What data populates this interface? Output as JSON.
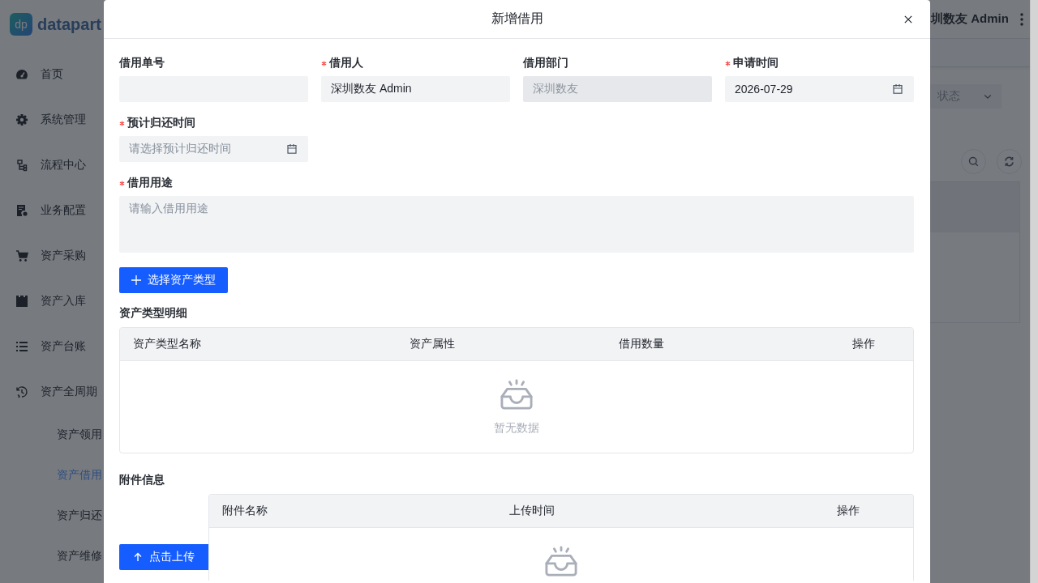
{
  "sidebar": {
    "logo": "dp",
    "brand": "datapart",
    "menu": [
      {
        "label": "首页",
        "selected": false
      },
      {
        "label": "系统管理",
        "selected": false
      },
      {
        "label": "流程中心",
        "selected": false
      },
      {
        "label": "业务配置",
        "selected": false
      },
      {
        "label": "资产采购",
        "selected": false
      },
      {
        "label": "资产入库",
        "selected": false
      },
      {
        "label": "资产台账",
        "selected": false
      },
      {
        "label": "资产全周期",
        "selected": false,
        "children": [
          {
            "label": "资产领用",
            "selected": false
          },
          {
            "label": "资产借用",
            "selected": true
          },
          {
            "label": "资产归还",
            "selected": false
          },
          {
            "label": "资产维修",
            "selected": false
          }
        ]
      }
    ]
  },
  "header": {
    "user": "圳数友 Admin"
  },
  "filters": {
    "status": {
      "placeholder": "状态"
    }
  },
  "modal": {
    "title": "新增借用",
    "fields": [
      {
        "label": "借用单号",
        "required": false,
        "kind": "input",
        "disabled": false
      },
      {
        "label": "借用人",
        "required": true,
        "kind": "input",
        "value": "深圳数友 Admin",
        "disabled": false
      },
      {
        "label": "借用部门",
        "required": false,
        "kind": "input",
        "value": "深圳数友",
        "disabled": true
      },
      {
        "label": "申请时间",
        "required": true,
        "kind": "date",
        "value": "2026-07-29",
        "disabled": false
      },
      {
        "label": "预计归还时间",
        "required": true,
        "kind": "date",
        "placeholder": "请选择预计归还时间",
        "disabled": false
      },
      {
        "label": "借用用途",
        "required": true,
        "kind": "textarea",
        "placeholder": "请输入借用用途",
        "disabled": false
      }
    ],
    "add_button": "选择资产类型",
    "asset_table": {
      "title": "资产类型明细",
      "columns": [
        "资产类型名称",
        "资产属性",
        "借用数量",
        "操作"
      ],
      "empty_text": "暂无数据"
    },
    "attachments": {
      "title": "附件信息",
      "upload_button": "点击上传",
      "columns": [
        "附件名称",
        "上传时间",
        "操作"
      ]
    }
  }
}
